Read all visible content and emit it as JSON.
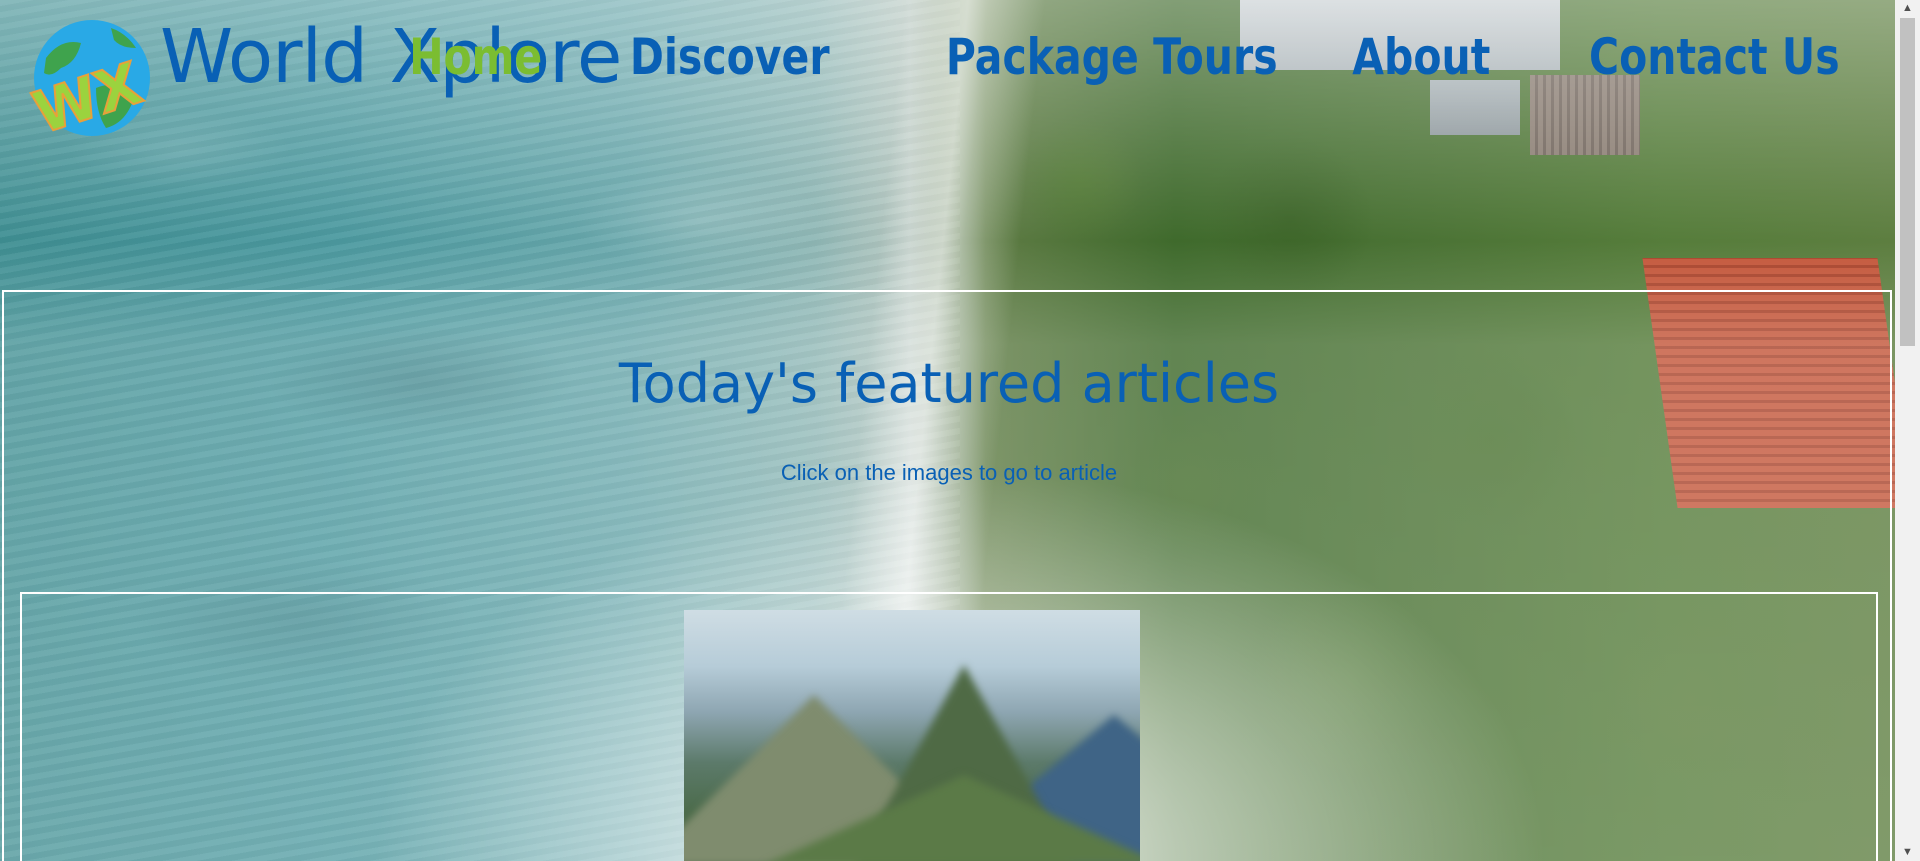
{
  "brand": {
    "logo_text": "WX",
    "title": "World Xplore"
  },
  "nav": {
    "items": [
      {
        "label": "Home",
        "active": true
      },
      {
        "label": "Discover",
        "active": false
      },
      {
        "label": "Package Tours",
        "active": false
      },
      {
        "label": "About",
        "active": false
      },
      {
        "label": "Contact Us",
        "active": false
      }
    ]
  },
  "featured": {
    "title": "Today's featured articles",
    "subtitle": "Click on the images to go to article",
    "articles": [
      {
        "image": "mountain-ruins-photo"
      }
    ]
  },
  "colors": {
    "brand_blue": "#0960b5",
    "active_green": "#7bbd31"
  }
}
